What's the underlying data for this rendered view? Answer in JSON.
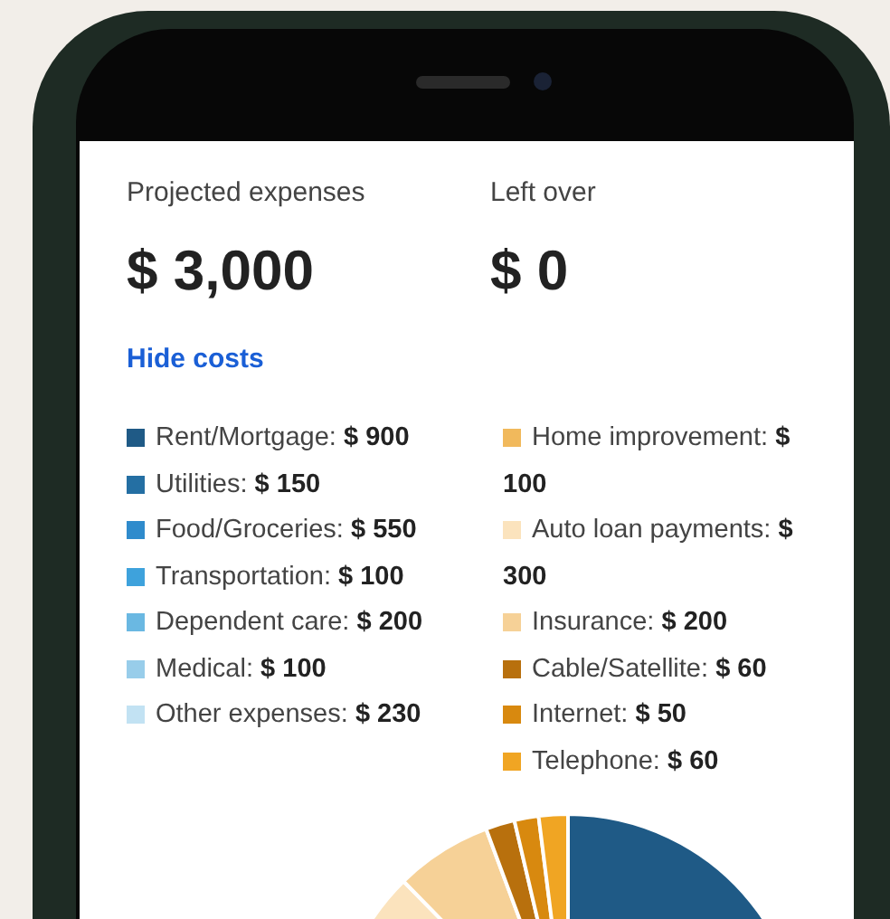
{
  "summary": [
    {
      "label": "Projected expenses",
      "value": "$ 3,000"
    },
    {
      "label": "Left over",
      "value": "$ 0"
    }
  ],
  "toggle_link": "Hide costs",
  "legend": [
    {
      "name": "Rent/Mortgage:",
      "amount": "$ 900",
      "color": "#1f5a86"
    },
    {
      "name": "Utilities:",
      "amount": "$ 150",
      "color": "#246fa3"
    },
    {
      "name": "Food/Groceries:",
      "amount": "$ 550",
      "color": "#2f8bcc"
    },
    {
      "name": "Transportation:",
      "amount": "$ 100",
      "color": "#3ea2dc"
    },
    {
      "name": "Dependent care:",
      "amount": "$ 200",
      "color": "#6ab8e2"
    },
    {
      "name": "Medical:",
      "amount": "$ 100",
      "color": "#98cdea"
    },
    {
      "name": "Other expenses:",
      "amount": "$ 230",
      "color": "#c2e2f3"
    },
    {
      "name": "Home improvement:",
      "amount": "$ 100",
      "color": "#f1b95c"
    },
    {
      "name": "Auto loan payments:",
      "amount": "$ 300",
      "color": "#fbe3bd"
    },
    {
      "name": "Insurance:",
      "amount": "$ 200",
      "color": "#f6d197"
    },
    {
      "name": "Cable/Satellite:",
      "amount": "$ 60",
      "color": "#b8700d"
    },
    {
      "name": "Internet:",
      "amount": "$ 50",
      "color": "#d8890f"
    },
    {
      "name": "Telephone:",
      "amount": "$ 60",
      "color": "#f0a523"
    }
  ]
}
